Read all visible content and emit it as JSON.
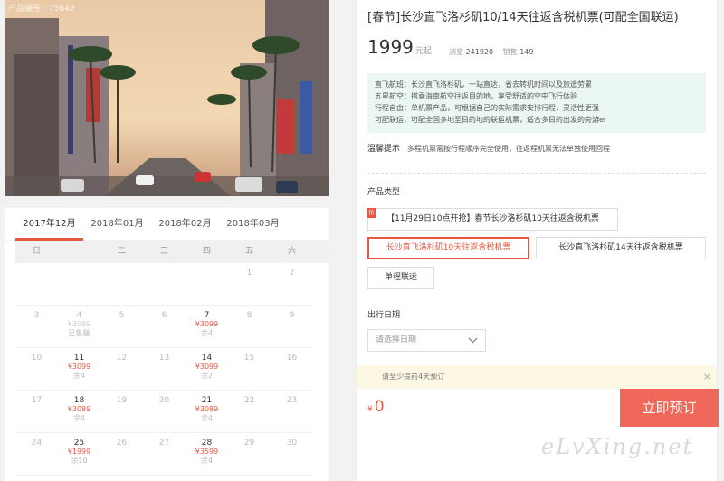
{
  "photo": {
    "product_no": "产品编号：75642"
  },
  "calendar": {
    "months": [
      "2017年12月",
      "2018年01月",
      "2018年02月",
      "2018年03月"
    ],
    "active_month": 0,
    "weekdays": [
      "日",
      "一",
      "二",
      "三",
      "四",
      "五",
      "六"
    ],
    "cells": [
      {
        "d": "",
        "p": "",
        "s": ""
      },
      {
        "d": "",
        "p": "",
        "s": ""
      },
      {
        "d": "",
        "p": "",
        "s": ""
      },
      {
        "d": "",
        "p": "",
        "s": ""
      },
      {
        "d": "",
        "p": "",
        "s": ""
      },
      {
        "d": "1",
        "p": "",
        "s": ""
      },
      {
        "d": "2",
        "p": "",
        "s": ""
      },
      {
        "d": "3",
        "p": "",
        "s": ""
      },
      {
        "d": "4",
        "p": "¥3099",
        "s": "已售罄",
        "off": true
      },
      {
        "d": "5",
        "p": "",
        "s": ""
      },
      {
        "d": "6",
        "p": "",
        "s": ""
      },
      {
        "d": "7",
        "p": "¥3099",
        "s": "余4",
        "on": true
      },
      {
        "d": "8",
        "p": "",
        "s": ""
      },
      {
        "d": "9",
        "p": "",
        "s": ""
      },
      {
        "d": "10",
        "p": "",
        "s": ""
      },
      {
        "d": "11",
        "p": "¥3099",
        "s": "余4",
        "on": true
      },
      {
        "d": "12",
        "p": "",
        "s": ""
      },
      {
        "d": "13",
        "p": "",
        "s": ""
      },
      {
        "d": "14",
        "p": "¥3099",
        "s": "余2",
        "on": true
      },
      {
        "d": "15",
        "p": "",
        "s": ""
      },
      {
        "d": "16",
        "p": "",
        "s": ""
      },
      {
        "d": "17",
        "p": "",
        "s": ""
      },
      {
        "d": "18",
        "p": "¥3089",
        "s": "余4",
        "on": true
      },
      {
        "d": "19",
        "p": "",
        "s": ""
      },
      {
        "d": "20",
        "p": "",
        "s": ""
      },
      {
        "d": "21",
        "p": "¥3089",
        "s": "余4",
        "on": true
      },
      {
        "d": "22",
        "p": "",
        "s": ""
      },
      {
        "d": "23",
        "p": "",
        "s": ""
      },
      {
        "d": "24",
        "p": "",
        "s": ""
      },
      {
        "d": "25",
        "p": "¥1999",
        "s": "余10",
        "on": true
      },
      {
        "d": "26",
        "p": "",
        "s": ""
      },
      {
        "d": "27",
        "p": "",
        "s": ""
      },
      {
        "d": "28",
        "p": "¥3599",
        "s": "余4",
        "on": true
      },
      {
        "d": "29",
        "p": "",
        "s": ""
      },
      {
        "d": "30",
        "p": "",
        "s": ""
      }
    ]
  },
  "product": {
    "title": "[春节]长沙直飞洛杉矶10/14天往返含税机票(可配全国联运)",
    "price": "1999",
    "price_suffix": "元起",
    "views_label": "浏览",
    "views": "241920",
    "sales_label": "销售",
    "sales": "149",
    "features": [
      "直飞航班：长沙直飞洛杉矶，一站直达，省去转机时间以及旅途劳累",
      "五星航空：搭乘海南航空往返目的地，享受舒适的空中飞行体验",
      "行程自由：单机票产品，可根据自己的实际需求安排行程，灵活性更强",
      "可配联运：可配全国多地至目的地的联运机票，适合多目的出发的旁游er"
    ],
    "tip_label": "温馨提示",
    "tip_text": "多程机票需按行程顺序完全使用，往返程机票无法单独使用回程"
  },
  "options": {
    "type_label": "产品类型",
    "promo": "【11月29日10点开抢】春节长沙洛杉矶10天往返含税机票",
    "promo_tag": "抢",
    "opt1": "长沙直飞洛杉矶10天往返含税机票",
    "opt2": "长沙直飞洛杉矶14天往返含税机票",
    "opt3": "单程联运",
    "date_label": "出行日期",
    "date_placeholder": "请选择日期"
  },
  "notice": {
    "text": "请至少提前4天预订",
    "close": "×"
  },
  "footer": {
    "currency": "¥",
    "total": "0",
    "book": "立即预订"
  },
  "watermark": "eLvXing.net",
  "colors": {
    "accent": "#e8563f",
    "book": "#f0685a",
    "feature_bg": "#eaf7f3"
  }
}
